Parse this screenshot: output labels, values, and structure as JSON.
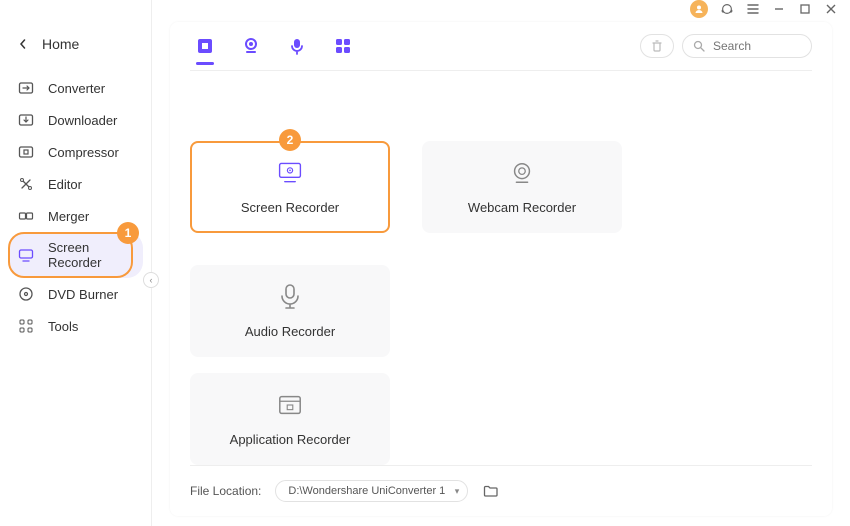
{
  "sidebar": {
    "home": "Home",
    "items": [
      {
        "label": "Converter"
      },
      {
        "label": "Downloader"
      },
      {
        "label": "Compressor"
      },
      {
        "label": "Editor"
      },
      {
        "label": "Merger"
      },
      {
        "label": "Screen Recorder"
      },
      {
        "label": "DVD Burner"
      },
      {
        "label": "Tools"
      }
    ],
    "highlight_badge_1": "1"
  },
  "toolbar": {
    "search_placeholder": "Search"
  },
  "cards": {
    "highlight_badge_2": "2",
    "screen_recorder": "Screen Recorder",
    "webcam_recorder": "Webcam Recorder",
    "audio_recorder": "Audio Recorder",
    "application_recorder": "Application Recorder"
  },
  "footer": {
    "file_location_label": "File Location:",
    "path": "D:\\Wondershare UniConverter 1"
  }
}
